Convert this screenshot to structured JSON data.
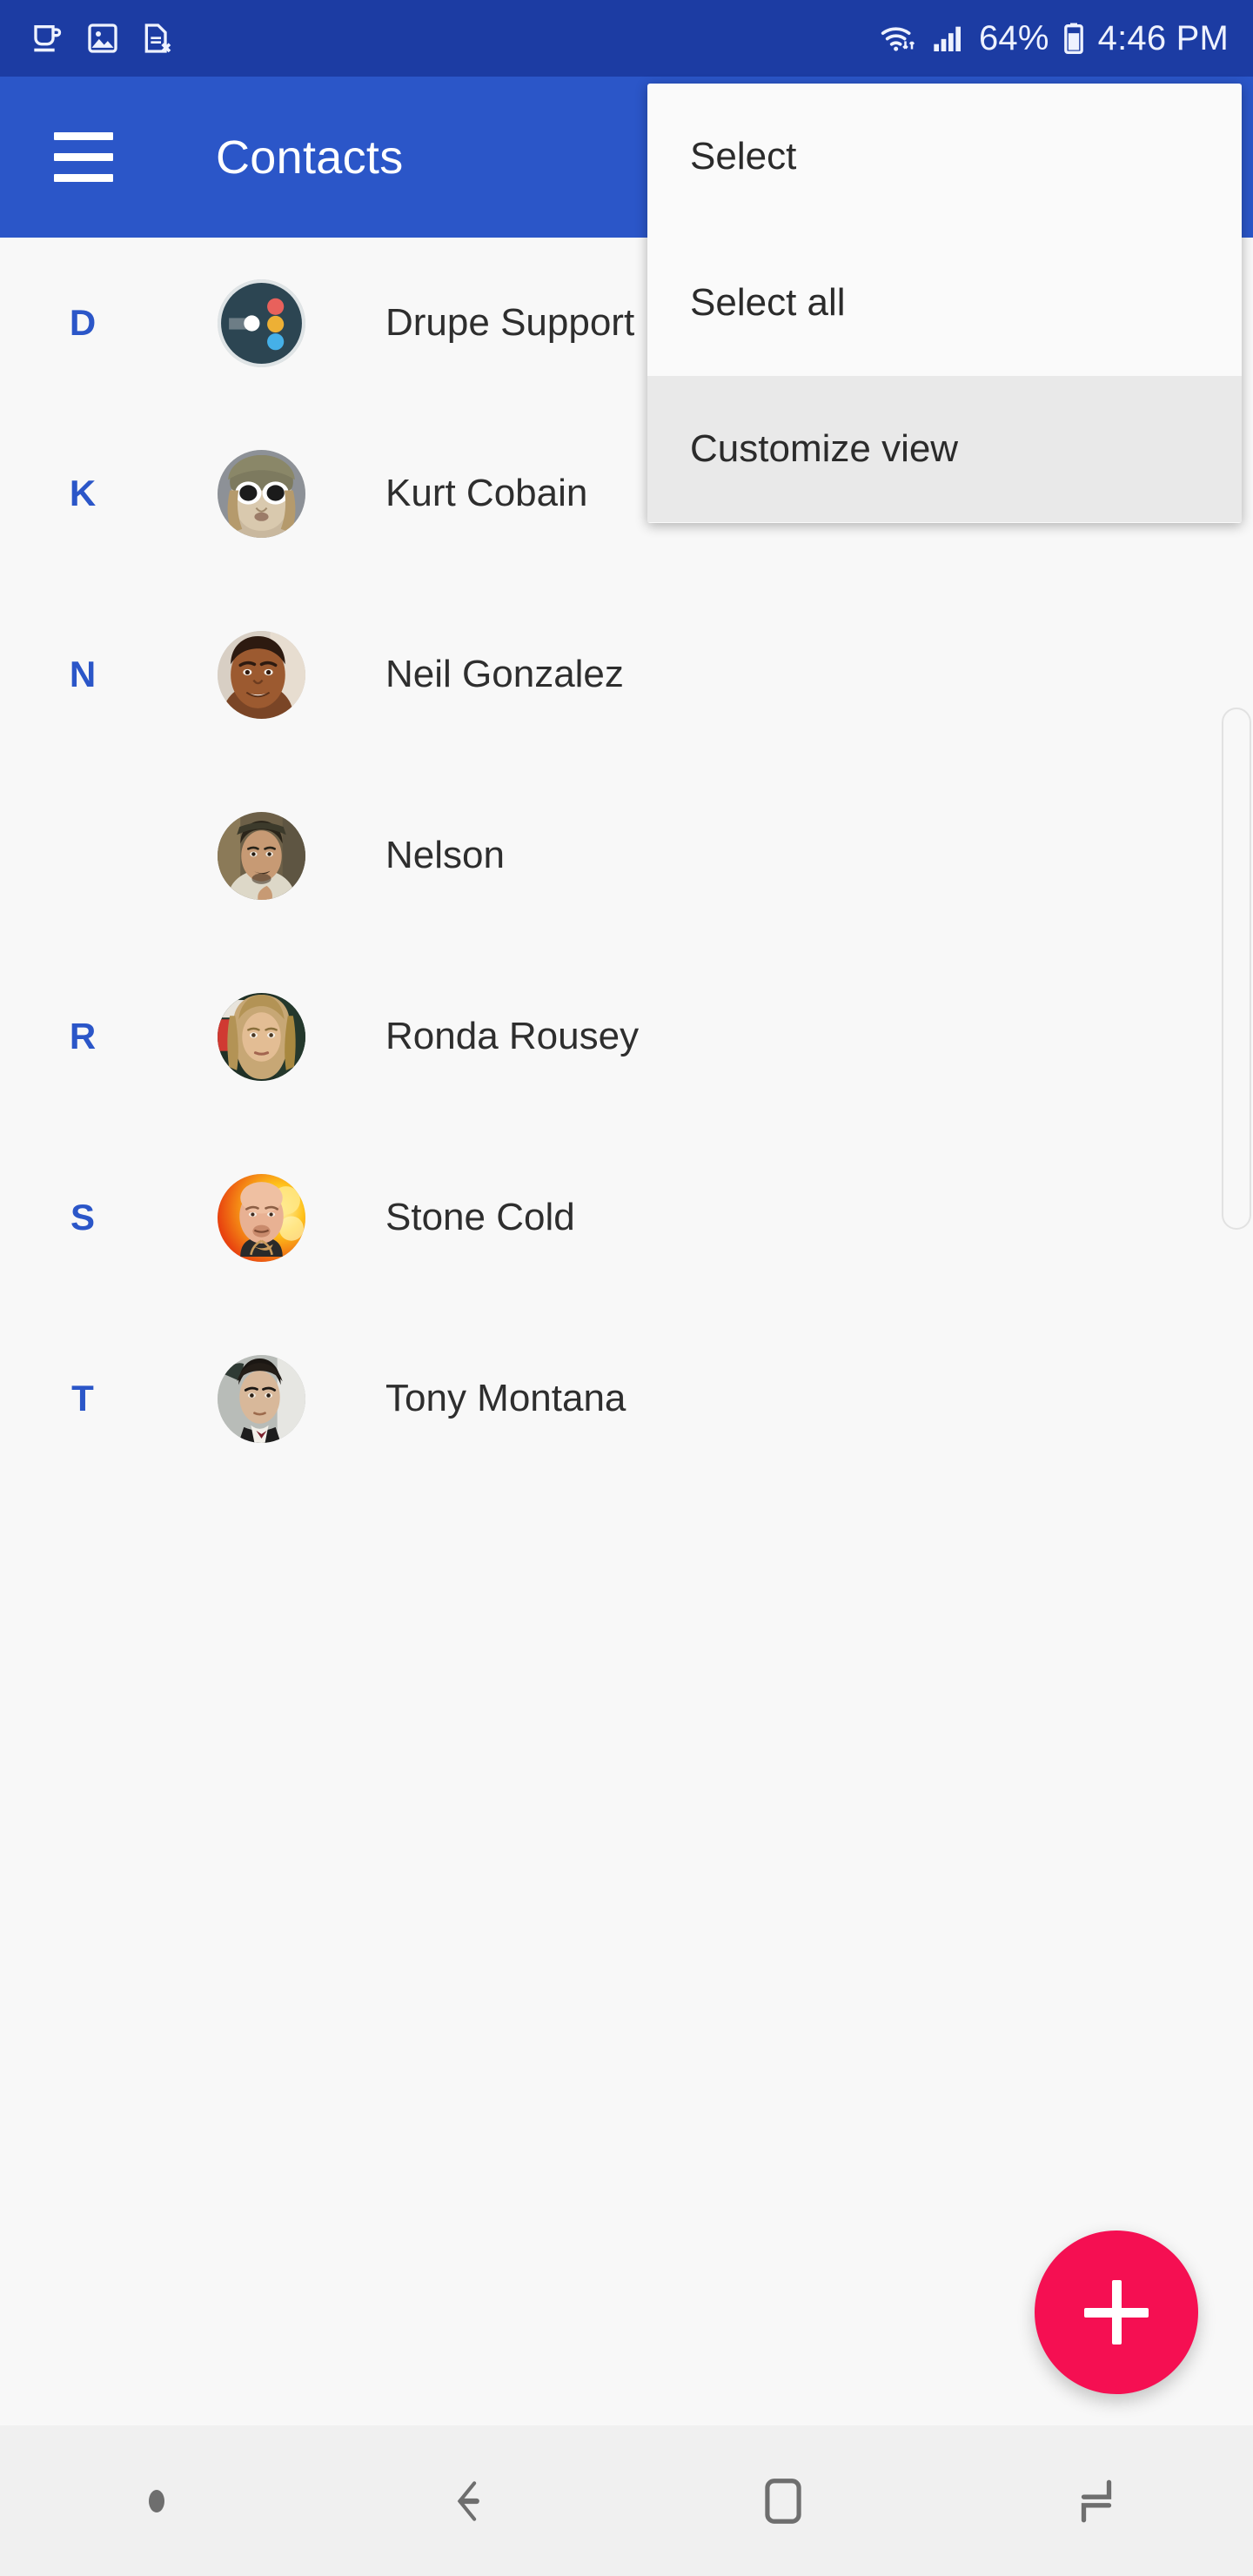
{
  "status_bar": {
    "icons": [
      "cup-icon",
      "image-icon",
      "sim-card-off-icon",
      "wifi-icon",
      "cellular-signal-icon",
      "battery-icon"
    ],
    "battery_percent": "64%",
    "clock": "4:46 PM",
    "background_color": "#1c3ca3",
    "text_color": "#eef2ff"
  },
  "app_bar": {
    "title": "Contacts",
    "menu_icon": "hamburger-icon",
    "background_color": "#2b56c8",
    "title_color": "#ffffff"
  },
  "overflow_menu": {
    "items": [
      {
        "label": "Select",
        "highlighted": false
      },
      {
        "label": "Select all",
        "highlighted": false
      },
      {
        "label": "Customize view",
        "highlighted": true
      }
    ],
    "background_color": "#fafafa",
    "highlight_color": "#e9e9e9"
  },
  "contacts": {
    "index_color": "#2b56c8",
    "name_color": "#2e2e2e",
    "list": [
      {
        "index": "D",
        "name": "Drupe Support",
        "avatar": "drupe-logo-avatar"
      },
      {
        "index": "K",
        "name": "Kurt Cobain",
        "avatar": "photo-avatar-kurt"
      },
      {
        "index": "N",
        "name": "Neil Gonzalez",
        "avatar": "photo-avatar-neil"
      },
      {
        "index": "",
        "name": "Nelson",
        "avatar": "photo-avatar-nelson"
      },
      {
        "index": "R",
        "name": "Ronda Rousey",
        "avatar": "photo-avatar-ronda"
      },
      {
        "index": "S",
        "name": "Stone Cold",
        "avatar": "photo-avatar-stonecold"
      },
      {
        "index": "T",
        "name": "Tony Montana",
        "avatar": "photo-avatar-tony"
      }
    ]
  },
  "fab": {
    "icon": "plus-icon",
    "color": "#f50f52"
  },
  "nav_bar": {
    "background_color": "#f0f0f0",
    "buttons": [
      "keyboard-indicator-dot",
      "back-button",
      "home-button",
      "recents-button"
    ]
  }
}
